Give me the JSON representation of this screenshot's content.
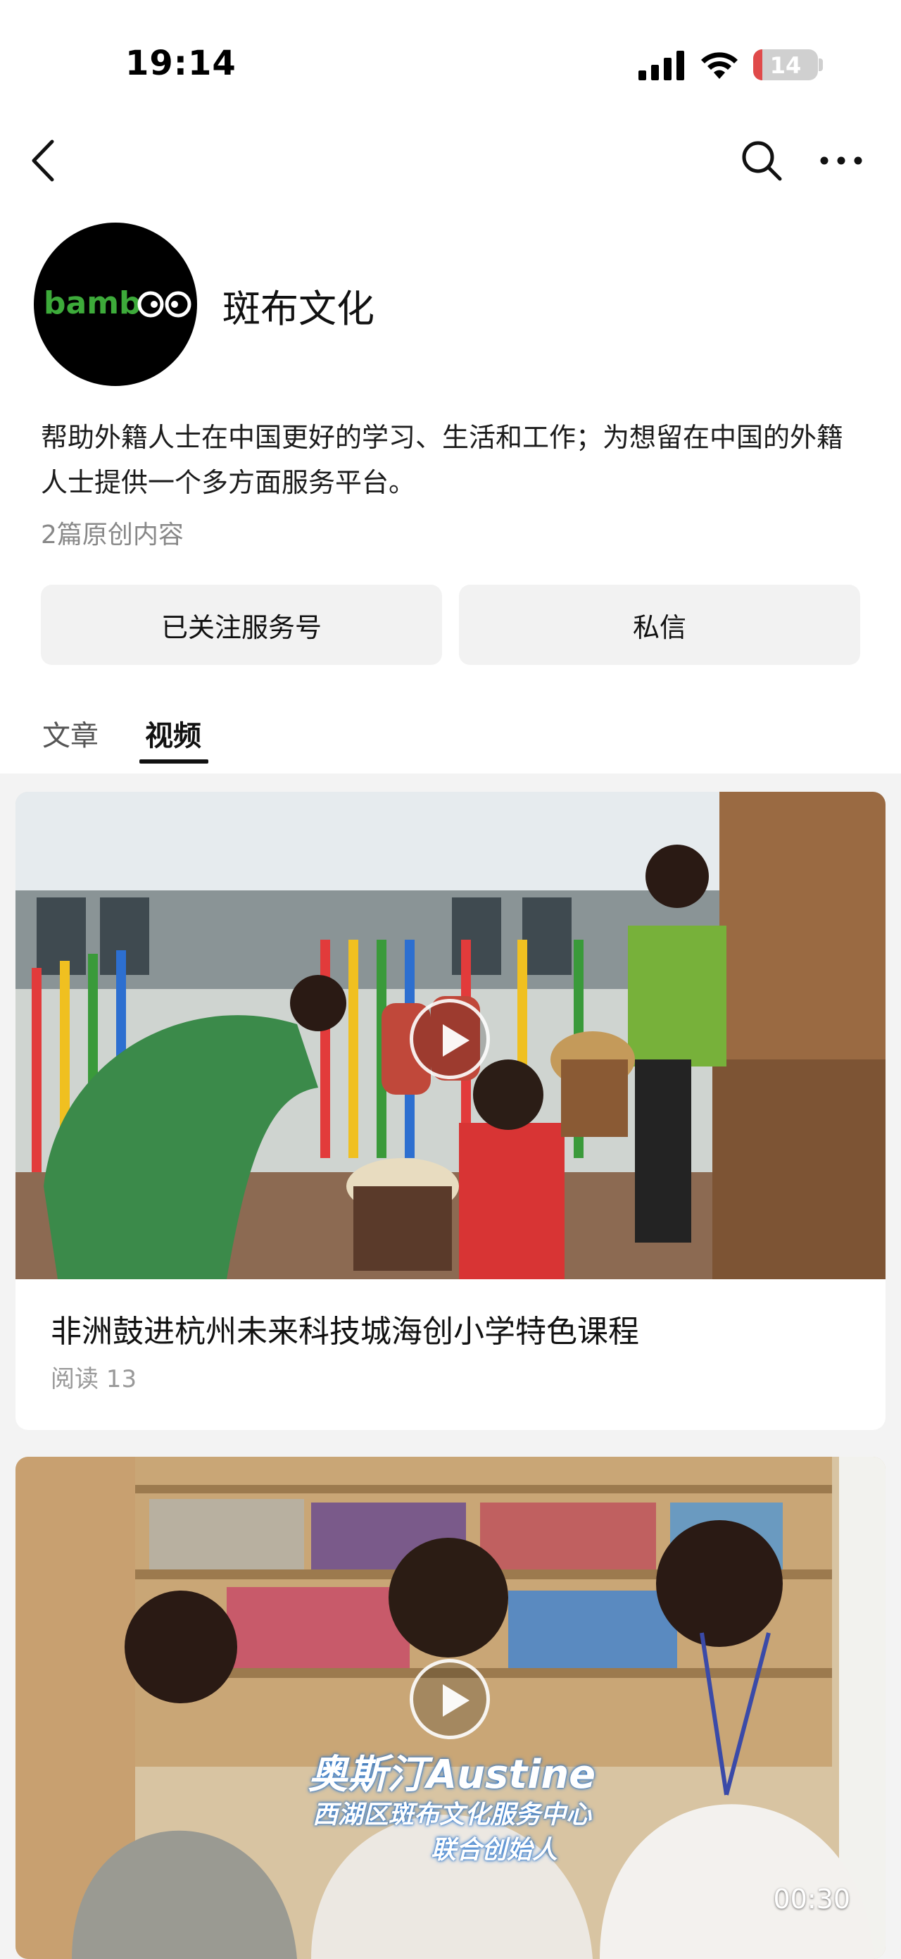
{
  "status_bar": {
    "time": "19:14",
    "battery_percent": 14,
    "battery_label": "14"
  },
  "nav": {
    "back_icon": "chevron-left-icon",
    "search_icon": "search-icon",
    "more_icon": "more-horizontal-icon"
  },
  "profile": {
    "logo_text": "bamboo",
    "name": "斑布文化",
    "bio": "帮助外籍人士在中国更好的学习、生活和工作；为想留在中国的外籍人士提供一个多方面服务平台。",
    "original_count": "2篇原创内容"
  },
  "actions": {
    "follow_label": "已关注服务号",
    "message_label": "私信"
  },
  "tabs": [
    {
      "label": "文章",
      "active": false
    },
    {
      "label": "视频",
      "active": true
    }
  ],
  "videos": [
    {
      "title": "非洲鼓进杭州未来科技城海创小学特色课程",
      "read_count": "阅读 13"
    },
    {
      "caption_name": "奥斯汀Austine",
      "caption_org": "西湖区斑布文化服务中心",
      "caption_role": "联合创始人",
      "duration": "00:30"
    }
  ],
  "colors": {
    "battery_low": "#e04a4a",
    "logo_green": "#3daa3a",
    "button_bg": "#f2f2f2",
    "feed_bg": "#f3f3f3"
  }
}
